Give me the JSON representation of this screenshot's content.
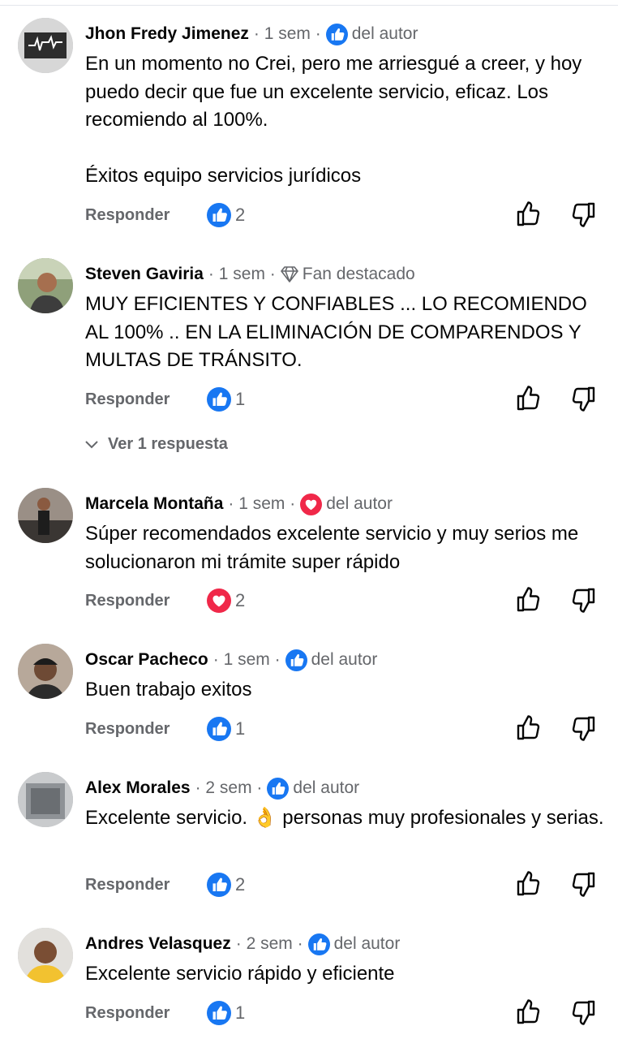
{
  "ui": {
    "reply_label": "Responder",
    "view_replies_label": "Ver 1 respuesta",
    "colors": {
      "like_blue": "#1877f2",
      "love_red": "#f02849",
      "muted": "#65676b",
      "name": "#050505"
    }
  },
  "comments": [
    {
      "name": "Jhon Fredy Jimenez",
      "time": "· 1 sem ·",
      "badge_icon": "like-icon",
      "badge_label": "del autor",
      "text": "En un momento no Crei, pero me arriesgué a creer, y hoy puedo decir que fue un excelente servicio, eficaz. Los recomiendo al 100%.\n\nÉxitos equipo servicios jurídicos",
      "reaction_icon": "like-icon",
      "reaction_count": "2"
    },
    {
      "name": "Steven Gaviria",
      "time": "· 1 sem ·",
      "badge_icon": "diamond-icon",
      "badge_label": "Fan destacado",
      "text": "MUY EFICIENTES Y CONFIABLES ... LO RECOMIENDO AL 100% .. EN LA ELIMINACIÓN DE COMPARENDOS Y MULTAS DE TRÁNSITO.",
      "reaction_icon": "like-icon",
      "reaction_count": "1"
    },
    {
      "name": "Marcela Montaña",
      "time": "· 1 sem ·",
      "badge_icon": "heart-icon",
      "badge_label": "del autor",
      "text": "Súper recomendados excelente servicio y muy serios me solucionaron mi trámite super rápido",
      "reaction_icon": "heart-icon",
      "reaction_count": "2"
    },
    {
      "name": "Oscar Pacheco",
      "time": "· 1 sem ·",
      "badge_icon": "like-icon",
      "badge_label": "del autor",
      "text": "Buen trabajo exitos",
      "reaction_icon": "like-icon",
      "reaction_count": "1"
    },
    {
      "name": "Alex Morales",
      "time": "· 2 sem ·",
      "badge_icon": "like-icon",
      "badge_label": "del autor",
      "text": "Excelente servicio. 👌 personas muy profesionales y serias.",
      "reaction_icon": "like-icon",
      "reaction_count": "2"
    },
    {
      "name": "Andres Velasquez",
      "time": "· 2 sem ·",
      "badge_icon": "like-icon",
      "badge_label": "del autor",
      "text": "Excelente servicio rápido y eficiente",
      "reaction_icon": "like-icon",
      "reaction_count": "1"
    }
  ]
}
